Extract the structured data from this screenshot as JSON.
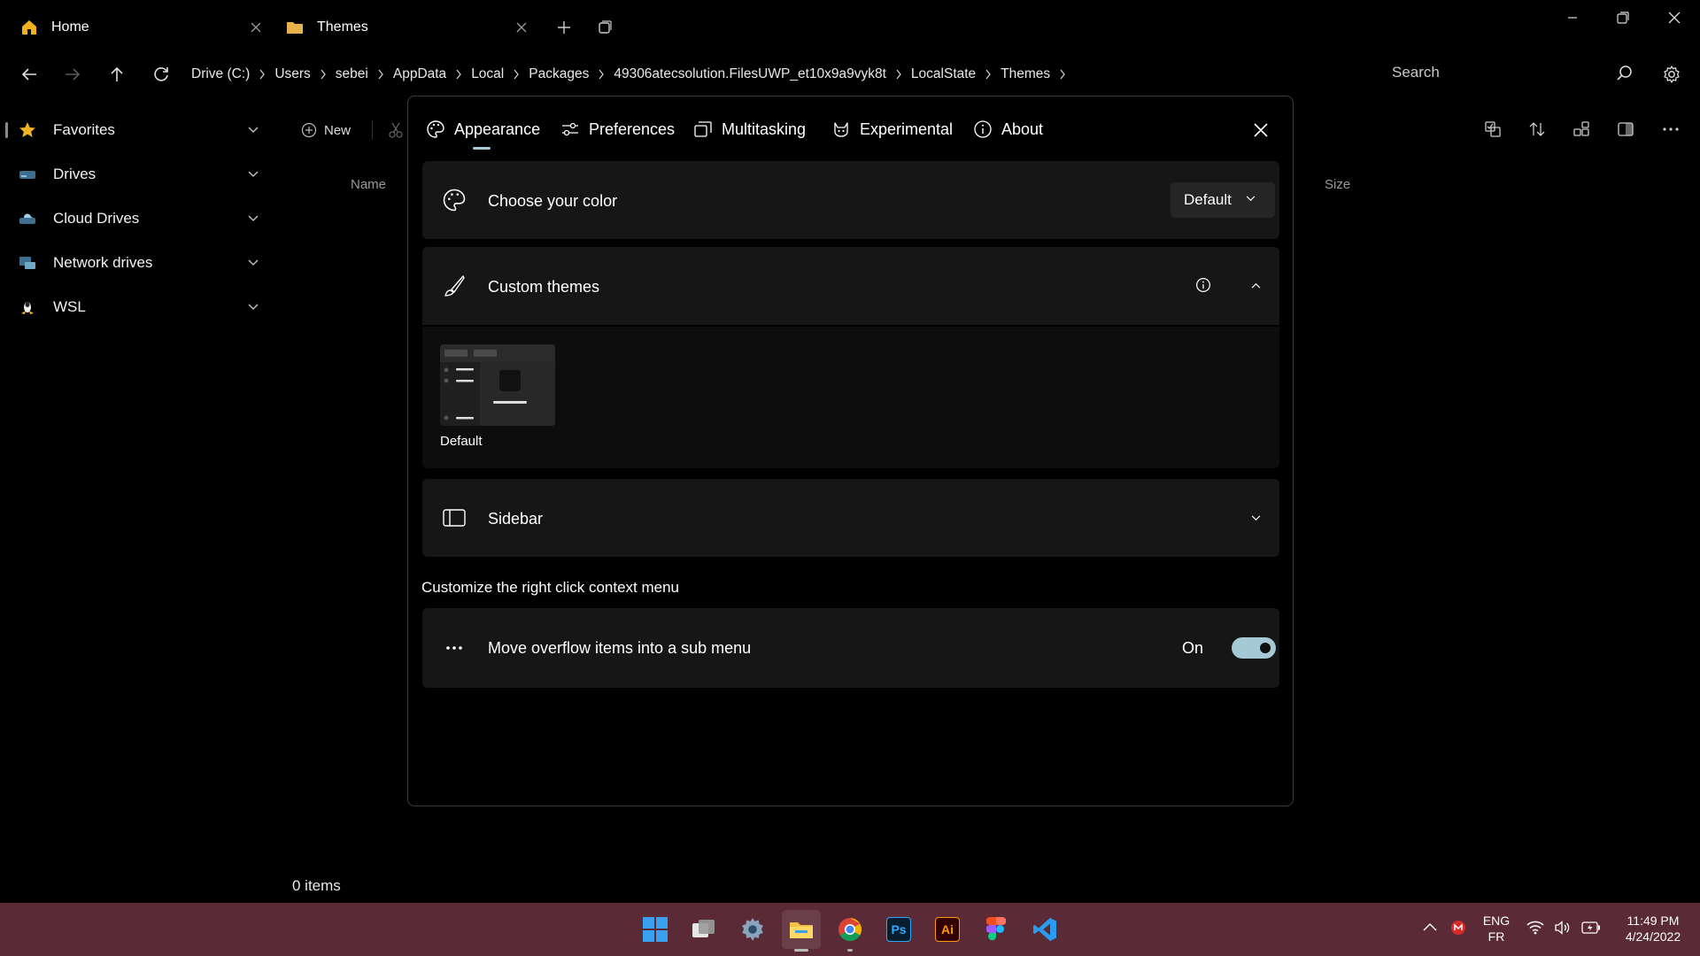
{
  "tabs": [
    {
      "label": "Home",
      "icon": "home-icon"
    },
    {
      "label": "Themes",
      "icon": "folder-icon"
    }
  ],
  "breadcrumbs": [
    "Drive (C:)",
    "Users",
    "sebei",
    "AppData",
    "Local",
    "Packages",
    "49306atecsolution.FilesUWP_et10x9a9vyk8t",
    "LocalState",
    "Themes"
  ],
  "search": {
    "placeholder": "Search"
  },
  "sidebar": {
    "items": [
      {
        "label": "Favorites",
        "icon": "star-icon"
      },
      {
        "label": "Drives",
        "icon": "drive-icon"
      },
      {
        "label": "Cloud Drives",
        "icon": "cloud-drive-icon"
      },
      {
        "label": "Network drives",
        "icon": "network-icon"
      },
      {
        "label": "WSL",
        "icon": "linux-icon"
      }
    ]
  },
  "toolbar": {
    "new_label": "New"
  },
  "columns": {
    "name": "Name",
    "size": "Size"
  },
  "status": {
    "item_count": "0 items"
  },
  "settings": {
    "tabs": [
      {
        "label": "Appearance",
        "icon": "palette-icon"
      },
      {
        "label": "Preferences",
        "icon": "sliders-icon"
      },
      {
        "label": "Multitasking",
        "icon": "multitask-icon"
      },
      {
        "label": "Experimental",
        "icon": "experimental-icon"
      },
      {
        "label": "About",
        "icon": "info-icon"
      }
    ],
    "color": {
      "label": "Choose your color",
      "value": "Default"
    },
    "custom_themes": {
      "label": "Custom themes",
      "themes": [
        {
          "name": "Default"
        }
      ]
    },
    "sidebar": {
      "label": "Sidebar"
    },
    "context_menu": {
      "section_title": "Customize the right click context menu",
      "overflow_label": "Move overflow items into a sub menu",
      "toggle_state": "On"
    }
  },
  "taskbar": {
    "apps": [
      "start-icon",
      "task-view-icon",
      "settings-app-icon",
      "file-explorer-icon",
      "chrome-icon",
      "photoshop-icon",
      "illustrator-icon",
      "figma-icon",
      "vscode-icon"
    ],
    "photoshop_label": "Ps",
    "illustrator_label": "Ai",
    "language": {
      "primary": "ENG",
      "secondary": "FR"
    },
    "time": "11:49 PM",
    "date": "4/24/2022"
  },
  "colors": {
    "accent": "#a6c9d6",
    "taskbar": "#5a2a36",
    "card": "#161616"
  }
}
